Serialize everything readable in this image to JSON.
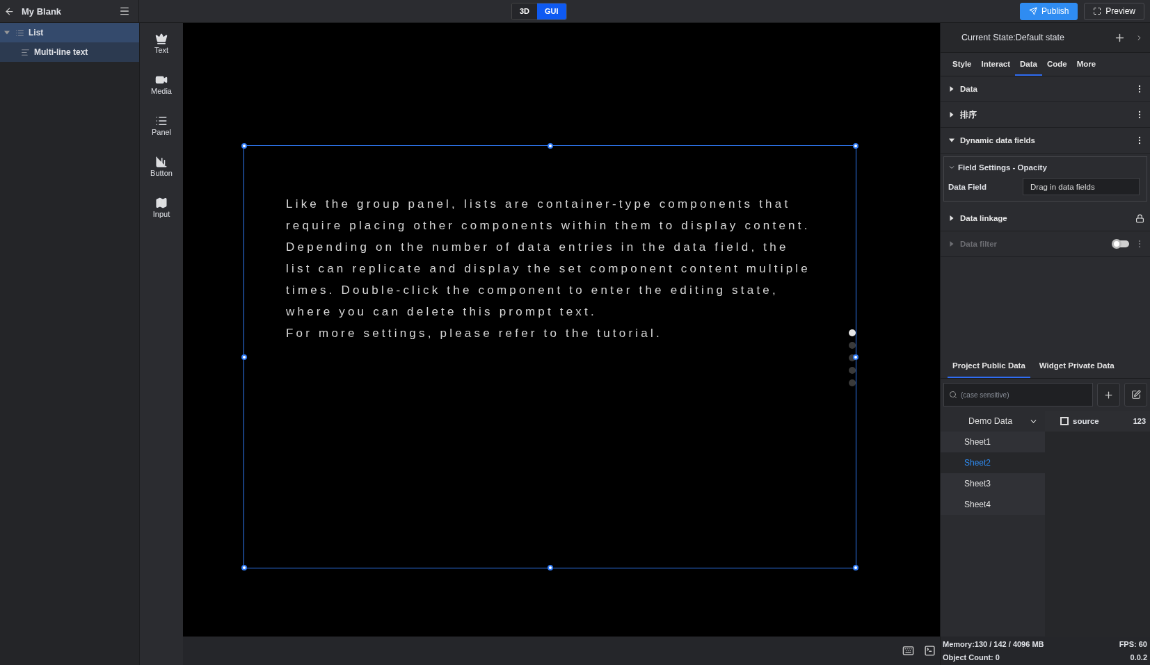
{
  "project": {
    "title": "My Blank"
  },
  "layers": [
    {
      "label": "List",
      "expanded": true,
      "selected": true,
      "children": [
        {
          "label": "Multi-line text",
          "selected": false
        }
      ]
    }
  ],
  "tools": [
    {
      "label": "Text"
    },
    {
      "label": "Media"
    },
    {
      "label": "Panel"
    },
    {
      "label": "Button"
    },
    {
      "label": "Input"
    }
  ],
  "mode_switch": [
    {
      "label": "3D",
      "selected": false
    },
    {
      "label": "GUI",
      "selected": true
    }
  ],
  "actions": [
    {
      "label": "Publish",
      "kind": "primary"
    },
    {
      "label": "Preview",
      "kind": "secondary"
    }
  ],
  "canvas": {
    "text": "Like the group panel, lists are container-type components that\nrequire placing other components within them to display content.\nDepending on the number of data entries in the data field, the\nlist can replicate and display the set component content multiple\ntimes. Double-click the component to enter the editing state,\nwhere you can delete this prompt text.\nFor more settings, please refer to the tutorial.",
    "pager": [
      {
        "selected": true
      },
      {
        "selected": false
      },
      {
        "selected": false
      },
      {
        "selected": false
      },
      {
        "selected": false
      }
    ]
  },
  "inspector": {
    "state": "Current State:Default state",
    "tabs": [
      {
        "label": "Style",
        "selected": false
      },
      {
        "label": "Interact",
        "selected": false
      },
      {
        "label": "Data",
        "selected": true
      },
      {
        "label": "Code",
        "selected": false
      },
      {
        "label": "More",
        "selected": false
      }
    ],
    "sections": [
      {
        "title": "Data",
        "kind": "menu",
        "expanded": false,
        "disabled": false
      },
      {
        "title": "排序",
        "kind": "menu",
        "expanded": false,
        "disabled": false
      },
      {
        "title": "Dynamic data fields",
        "kind": "menu",
        "expanded": true,
        "disabled": false,
        "field_settings": {
          "title": "Field Settings - Opacity",
          "expanded": true,
          "field_label": "Data Field",
          "placeholder": "Drag in data fields"
        }
      },
      {
        "title": "Data linkage",
        "kind": "locked",
        "expanded": false,
        "disabled": false
      },
      {
        "title": "Data filter",
        "kind": "toggle",
        "expanded": false,
        "disabled": true,
        "on": false
      }
    ]
  },
  "data_panel": {
    "tabs": [
      {
        "label": "Project Public Data",
        "selected": true
      },
      {
        "label": "Widget Private Data",
        "selected": false
      }
    ],
    "search": {
      "placeholder": "(case sensitive)"
    },
    "source": "Demo Data",
    "sheets": [
      {
        "label": "Sheet1",
        "selected": false
      },
      {
        "label": "Sheet2",
        "selected": true
      },
      {
        "label": "Sheet3",
        "selected": false
      },
      {
        "label": "Sheet4",
        "selected": false
      }
    ],
    "fields": [
      {
        "name": "source",
        "checked": false,
        "type": "123"
      }
    ]
  },
  "status": {
    "memory": "Memory:130 / 142 / 4096 MB",
    "fps": "FPS: 60",
    "objects": "Object Count: 0",
    "version": "0.0.2"
  }
}
